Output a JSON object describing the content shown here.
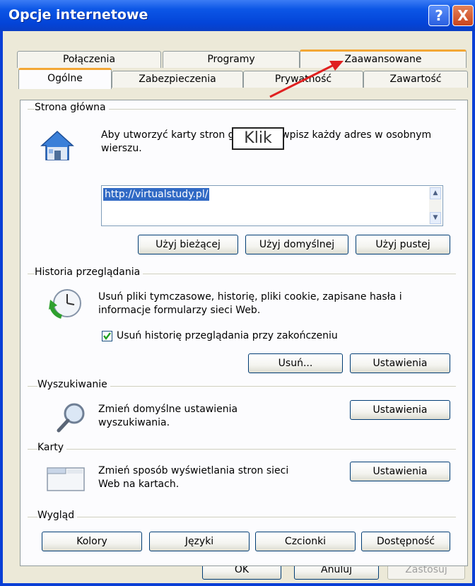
{
  "window": {
    "title": "Opcje internetowe",
    "help_label": "?",
    "close_label": "X"
  },
  "tabs_back": [
    {
      "label": "Połączenia"
    },
    {
      "label": "Programy"
    },
    {
      "label": "Zaawansowane"
    }
  ],
  "tabs_front": [
    {
      "label": "Ogólne"
    },
    {
      "label": "Zabezpieczenia"
    },
    {
      "label": "Prywatność"
    },
    {
      "label": "Zawartość"
    }
  ],
  "annotation": {
    "label": "Klik"
  },
  "home": {
    "section_title": "Strona główna",
    "description": "Aby utworzyć karty stron głównych, wpisz każdy adres w osobnym wierszu.",
    "url": "http://virtualstudy.pl/",
    "btn_current": "Użyj bieżącej",
    "btn_default": "Użyj domyślnej",
    "btn_blank": "Użyj pustej"
  },
  "history": {
    "section_title": "Historia przeglądania",
    "description": "Usuń pliki tymczasowe, historię, pliki cookie, zapisane hasła i informacje formularzy sieci Web.",
    "checkbox_label": "Usuń historię przeglądania przy zakończeniu",
    "checkbox_checked": true,
    "btn_delete": "Usuń...",
    "btn_settings": "Ustawienia"
  },
  "search": {
    "section_title": "Wyszukiwanie",
    "description": "Zmień domyślne ustawienia wyszukiwania.",
    "btn_settings": "Ustawienia"
  },
  "tabs_section": {
    "section_title": "Karty",
    "description": "Zmień sposób wyświetlania stron sieci Web na kartach.",
    "btn_settings": "Ustawienia"
  },
  "appearance": {
    "section_title": "Wygląd",
    "btn_colors": "Kolory",
    "btn_languages": "Języki",
    "btn_fonts": "Czcionki",
    "btn_accessibility": "Dostępność"
  },
  "footer": {
    "ok": "OK",
    "cancel": "Anuluj",
    "apply": "Zastosuj"
  },
  "colors": {
    "titlebar": "#0a3fd6",
    "dialog_bg": "#ece9d8",
    "tab_highlight": "#f3a735",
    "selection": "#316ac5",
    "arrow": "#e02020"
  }
}
